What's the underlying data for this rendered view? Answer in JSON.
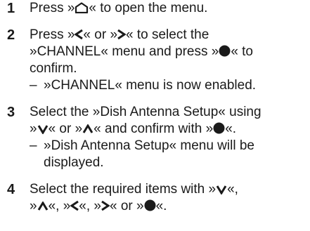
{
  "steps": [
    {
      "num": "1",
      "lines": [
        [
          {
            "t": "text",
            "v": "Press »"
          },
          {
            "t": "icon",
            "icon": "home-icon"
          },
          {
            "t": "text",
            "v": "« to open the menu."
          }
        ]
      ],
      "sub": []
    },
    {
      "num": "2",
      "lines": [
        [
          {
            "t": "text",
            "v": "Press »"
          },
          {
            "t": "icon",
            "icon": "arrow-left-icon"
          },
          {
            "t": "text",
            "v": "« or »"
          },
          {
            "t": "icon",
            "icon": "arrow-right-icon"
          },
          {
            "t": "text",
            "v": "« to select the"
          }
        ],
        [
          {
            "t": "text",
            "v": "»CHANNEL« menu and press »"
          },
          {
            "t": "icon",
            "icon": "ok-dot-icon"
          },
          {
            "t": "text",
            "v": "« to"
          }
        ],
        [
          {
            "t": "text",
            "v": "confirm."
          }
        ]
      ],
      "sub": [
        "»CHANNEL« menu is now enabled."
      ]
    },
    {
      "num": "3",
      "lines": [
        [
          {
            "t": "text",
            "v": "Select the »Dish Antenna Setup« using"
          }
        ],
        [
          {
            "t": "text",
            "v": "»"
          },
          {
            "t": "icon",
            "icon": "arrow-down-icon"
          },
          {
            "t": "text",
            "v": "« or »"
          },
          {
            "t": "icon",
            "icon": "arrow-up-icon"
          },
          {
            "t": "text",
            "v": "« and confirm with »"
          },
          {
            "t": "icon",
            "icon": "ok-dot-icon"
          },
          {
            "t": "text",
            "v": "«."
          }
        ]
      ],
      "sub": [
        "»Dish Antenna Setup« menu will be displayed."
      ]
    },
    {
      "num": "4",
      "lines": [
        [
          {
            "t": "text",
            "v": "Select the required items with »"
          },
          {
            "t": "icon",
            "icon": "arrow-down-icon"
          },
          {
            "t": "text",
            "v": "«,"
          }
        ],
        [
          {
            "t": "text",
            "v": "»"
          },
          {
            "t": "icon",
            "icon": "arrow-up-icon"
          },
          {
            "t": "text",
            "v": "«, »"
          },
          {
            "t": "icon",
            "icon": "arrow-left-icon"
          },
          {
            "t": "text",
            "v": "«, »"
          },
          {
            "t": "icon",
            "icon": "arrow-right-icon"
          },
          {
            "t": "text",
            "v": "« or »"
          },
          {
            "t": "icon",
            "icon": "ok-dot-icon"
          },
          {
            "t": "text",
            "v": "«."
          }
        ]
      ],
      "sub": []
    }
  ],
  "sub_dash": "–"
}
